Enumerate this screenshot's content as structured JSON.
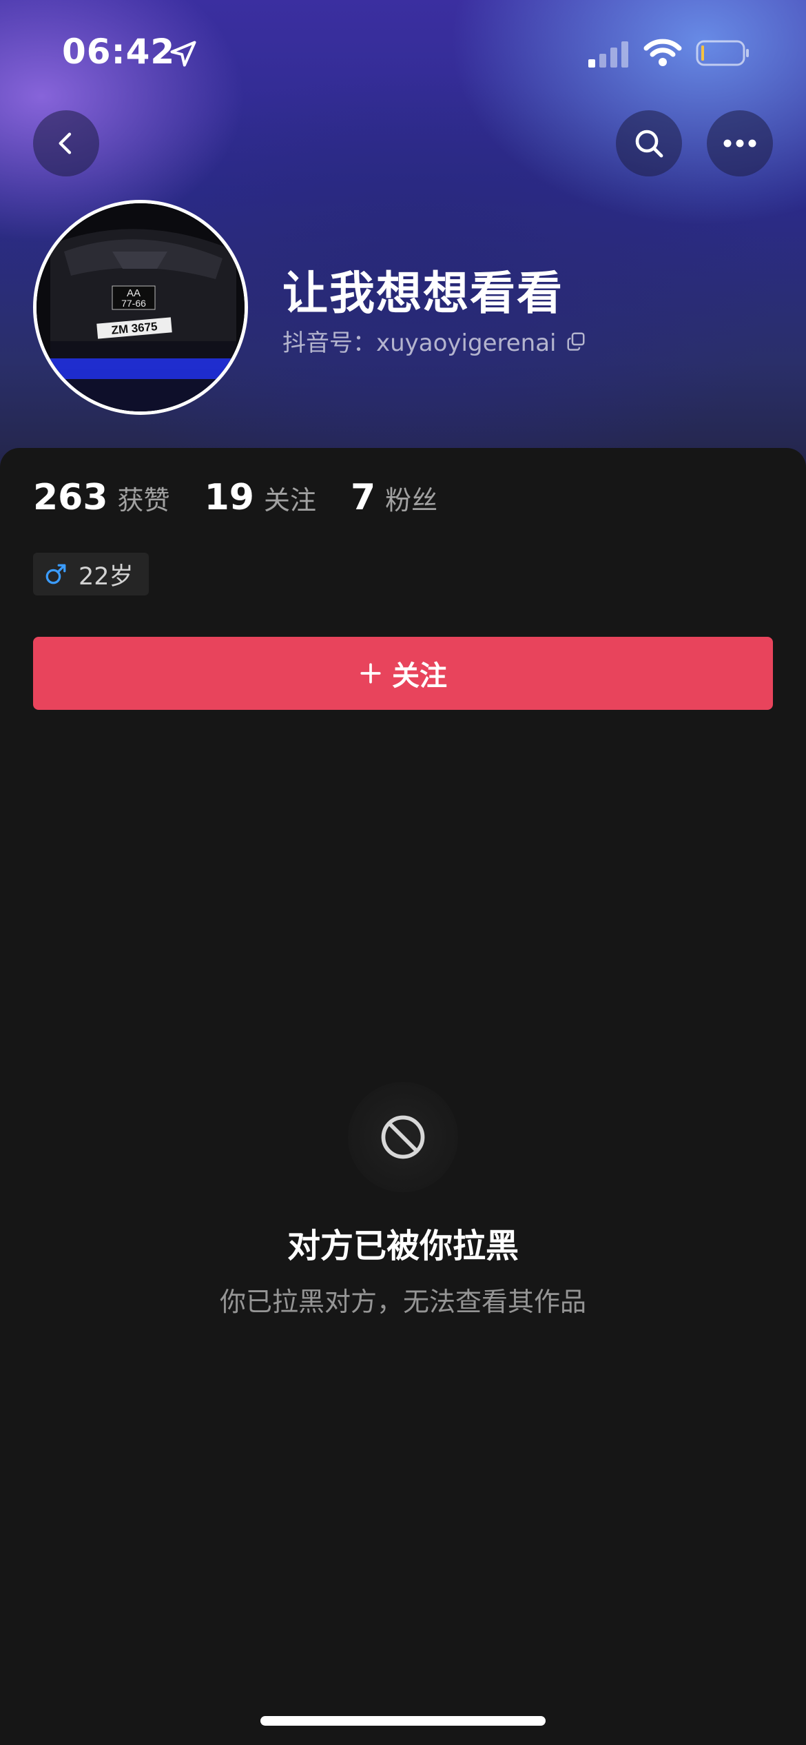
{
  "status_bar": {
    "time": "06:42"
  },
  "profile": {
    "nickname": "让我想想看看",
    "douyin_id": "抖音号：xuyaoyigerenai",
    "avatar_plate_top": "AA 77-66",
    "avatar_plate_bottom": "ZM 3675"
  },
  "stats": [
    {
      "value": "263",
      "label": "获赞"
    },
    {
      "value": "19",
      "label": "关注"
    },
    {
      "value": "7",
      "label": "粉丝"
    }
  ],
  "tag": {
    "text": "22岁",
    "icon": "male-icon"
  },
  "follow_button": {
    "label": "关注"
  },
  "blocked": {
    "title": "对方已被你拉黑",
    "description": "你已拉黑对方，无法查看其作品"
  },
  "colors": {
    "accent": "#e8445c",
    "background": "#161616",
    "male_blue": "#3b9cff"
  }
}
